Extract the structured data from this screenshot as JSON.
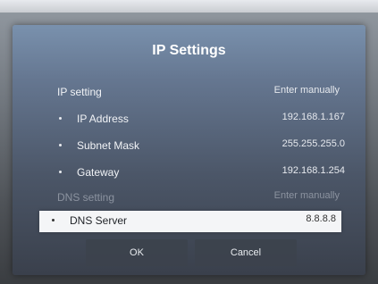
{
  "dialog": {
    "title": "IP Settings",
    "ip_setting": {
      "label": "IP setting",
      "value": "Enter manually"
    },
    "ip_address": {
      "label": "IP Address",
      "value": "192.168.1.167"
    },
    "subnet_mask": {
      "label": "Subnet Mask",
      "value": "255.255.255.0"
    },
    "gateway": {
      "label": "Gateway",
      "value": "192.168.1.254"
    },
    "dns_setting": {
      "label": "DNS setting",
      "value": "Enter manually"
    },
    "dns_server": {
      "label": "DNS Server",
      "value": "8.8.8.8"
    },
    "buttons": {
      "ok": "OK",
      "cancel": "Cancel"
    }
  }
}
